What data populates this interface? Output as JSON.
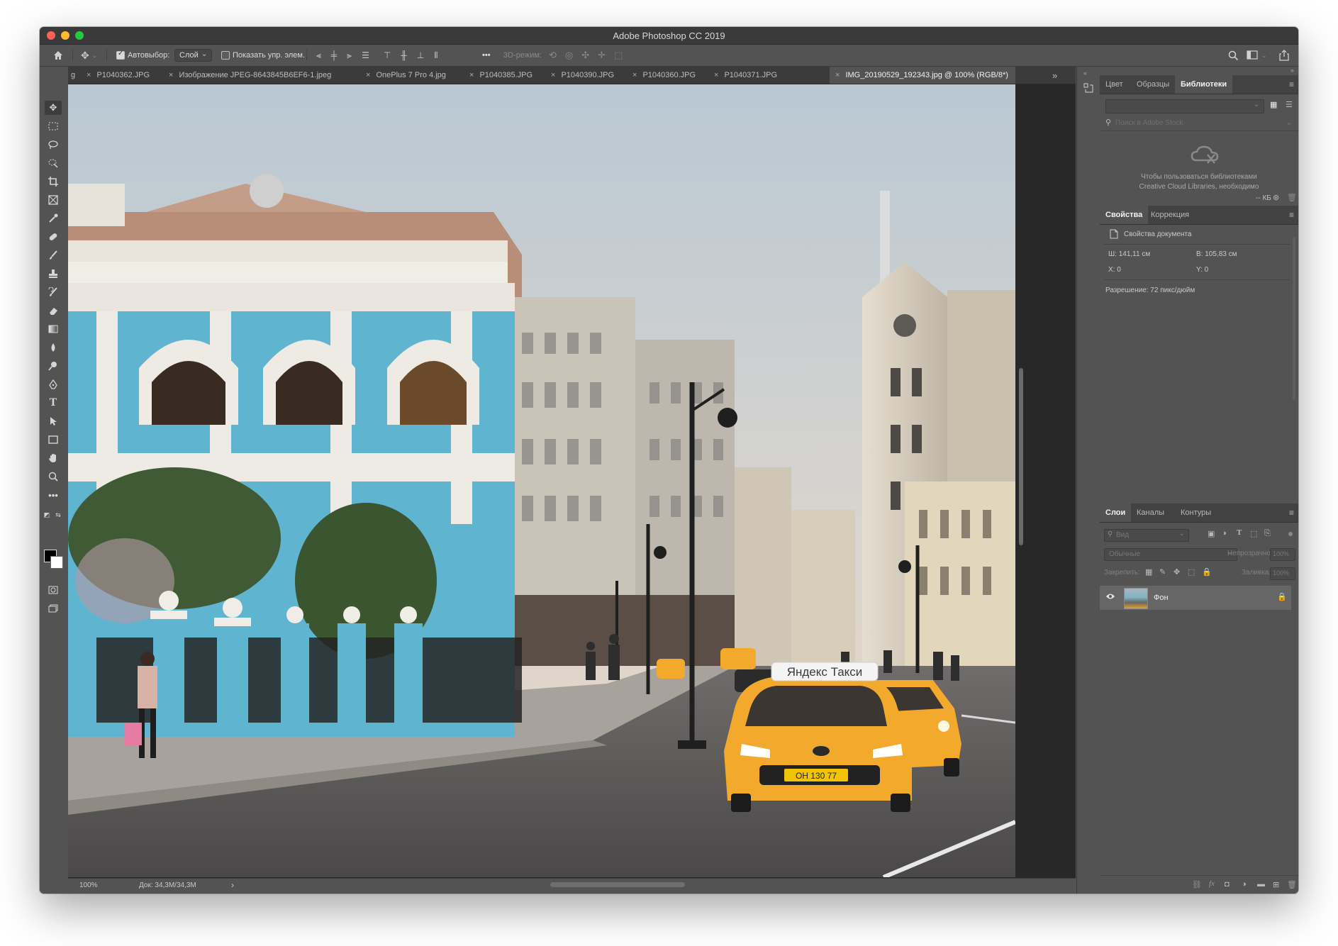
{
  "window": {
    "title": "Adobe Photoshop CC 2019"
  },
  "options": {
    "auto_select_label": "Автовыбор:",
    "auto_select_value": "Слой",
    "show_controls_label": "Показать упр. элем.",
    "mode_3d_label": "3D-режим:",
    "more_label": "•••"
  },
  "tabs": [
    {
      "label": "g"
    },
    {
      "label": "P1040362.JPG"
    },
    {
      "label": "Изображение JPEG-8643845B6EF6-1.jpeg"
    },
    {
      "label": "OnePlus 7 Pro 4.jpg"
    },
    {
      "label": "P1040385.JPG"
    },
    {
      "label": "P1040390.JPG"
    },
    {
      "label": "P1040360.JPG"
    },
    {
      "label": "P1040371.JPG"
    },
    {
      "label": "IMG_20190529_192343.jpg @ 100% (RGB/8*)"
    }
  ],
  "tabs_overflow": "»",
  "canvas": {
    "taxi_sign": "Яндекс Такси",
    "plate": "ОН 130 77"
  },
  "status": {
    "zoom": "100%",
    "doc": "Док: 34,3M/34,3M",
    "arrow": "›"
  },
  "libraries_panel": {
    "tabs": [
      "Цвет",
      "Образцы",
      "Библиотеки"
    ],
    "active_tab": "Библиотеки",
    "search_placeholder": "Поиск в Adobe Stock",
    "message_line1": "Чтобы пользоваться библиотеками",
    "message_line2": "Creative Cloud Libraries, необходимо",
    "size": "-- КБ"
  },
  "properties_panel": {
    "tabs": [
      "Свойства",
      "Коррекция"
    ],
    "active_tab": "Свойства",
    "doc_label": "Свойства документа",
    "width": "Ш: 141,11 см",
    "height": "В: 105,83 см",
    "x": "X: 0",
    "y": "Y: 0",
    "resolution": "Разрешение: 72 пикс/дюйм"
  },
  "layers_panel": {
    "tabs": [
      "Слои",
      "Каналы",
      "Контуры"
    ],
    "active_tab": "Слои",
    "filter_placeholder": "Вид",
    "blend_mode": "Обычные",
    "opacity_label": "Непрозрачность:",
    "opacity_value": "100%",
    "lock_label": "Закрепить:",
    "fill_label": "Заливка:",
    "fill_value": "100%",
    "layer_name": "Фон",
    "footer_fx": "fx"
  },
  "colors": {
    "panel_bg": "#535353",
    "tab_bar_bg": "#3b3b3b",
    "titlebar_bg": "#3a3a3a",
    "selected_layer": "#666666",
    "taxi_yellow": "#f2a92c",
    "building_blue": "#5fb4cf"
  }
}
